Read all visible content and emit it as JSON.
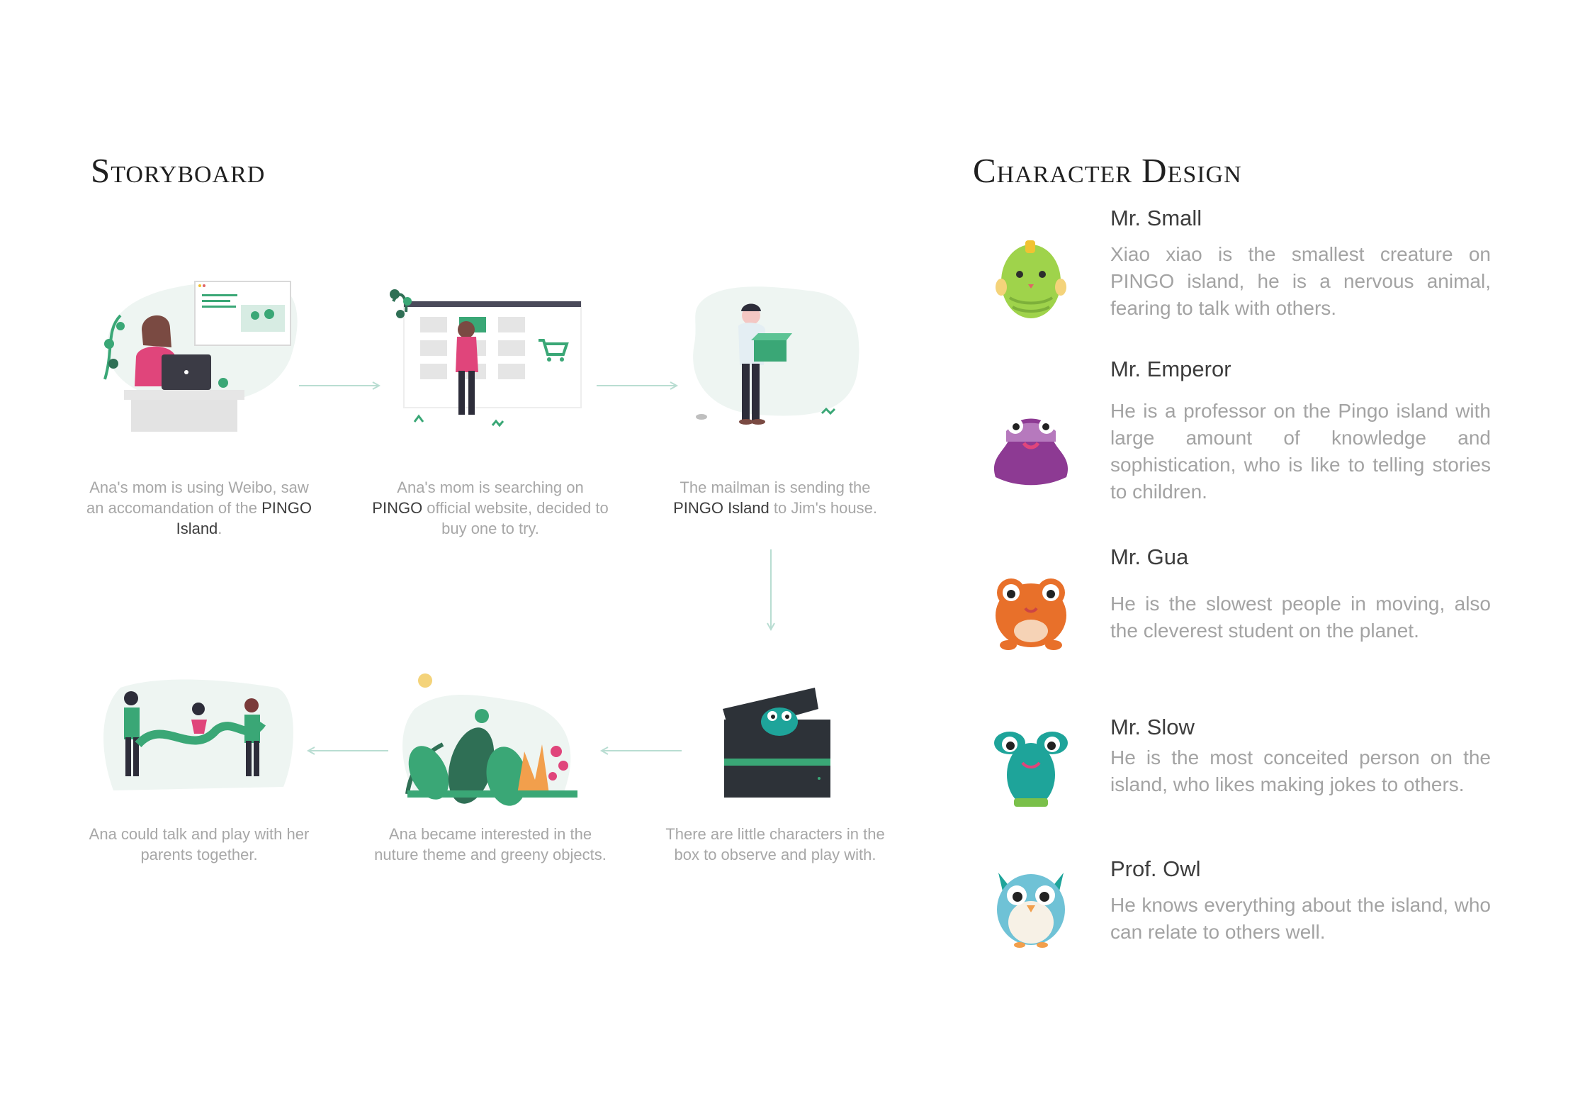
{
  "storyboard": {
    "title": "Storyboard",
    "steps": [
      {
        "pre": "Ana's mom is using Weibo, saw an accomandation of the ",
        "highlight": "PINGO Island",
        "post": "."
      },
      {
        "pre": "Ana's mom is searching on ",
        "highlight": "PINGO",
        "post": " official website, decided to buy one to try."
      },
      {
        "pre": "The mailman is sending the ",
        "highlight": "PINGO Island",
        "post": " to Jim's house."
      },
      {
        "pre": "There are little characters in the box to observe and play with.",
        "highlight": "",
        "post": ""
      },
      {
        "pre": "Ana became interested in the nuture theme and greeny objects.",
        "highlight": "",
        "post": ""
      },
      {
        "pre": "Ana could talk and play with her parents together.",
        "highlight": "",
        "post": ""
      }
    ]
  },
  "character_design": {
    "title": "Character Design",
    "characters": [
      {
        "name": "Mr. Small",
        "desc": "Xiao xiao is the smallest creature on PINGO island, he is a nervous animal, fearing to talk with others.",
        "color": "#9fd34b"
      },
      {
        "name": "Mr. Emperor",
        "desc": "He is a professor on the  Pingo island with large amount of knowledge and sophistication, who is like to telling stories to children.",
        "color": "#8d3a93"
      },
      {
        "name": "Mr. Gua",
        "desc": "He is the slowest people in moving, also the cleverest student on the planet.",
        "color": "#e8702a"
      },
      {
        "name": "Mr. Slow",
        "desc": "He is the most conceited person on the island, who likes making jokes to others.",
        "color": "#1ea49a"
      },
      {
        "name": "Prof. Owl",
        "desc": "He knows everything about the island, who can relate to others well.",
        "color": "#6fc2d6"
      }
    ]
  },
  "colors": {
    "accent": "#3aa776",
    "arrow": "#b9ddd2",
    "highlight_text": "#3d3d3d",
    "body_text": "#a3a3a3"
  }
}
